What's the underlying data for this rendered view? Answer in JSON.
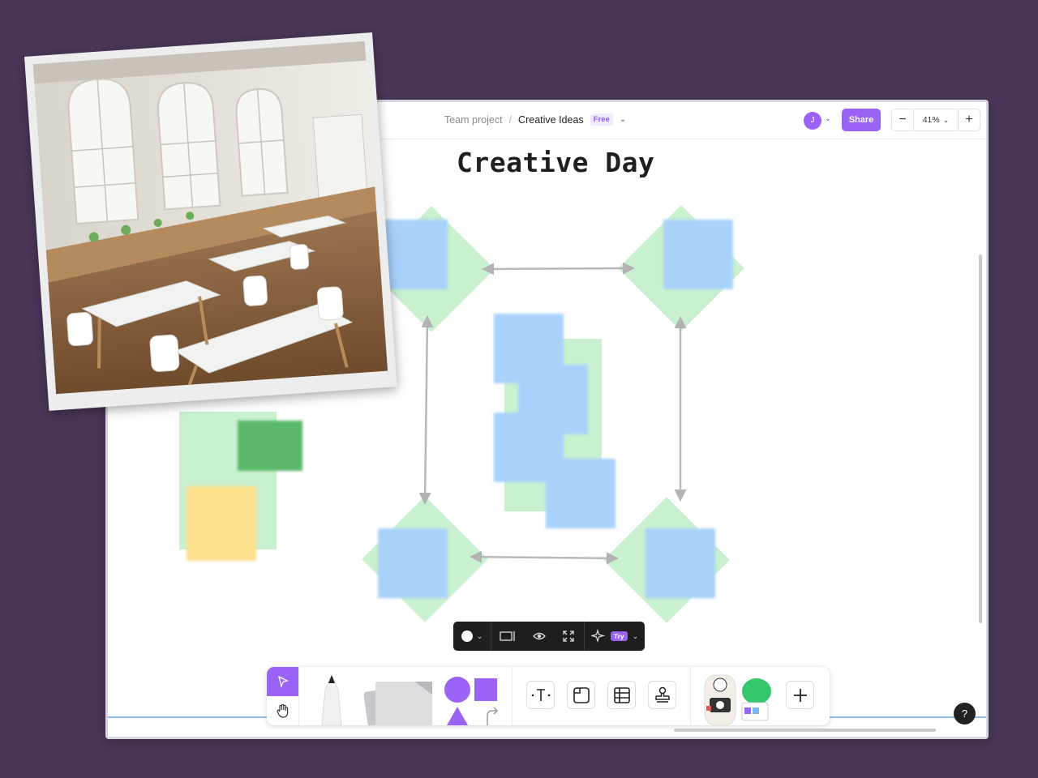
{
  "breadcrumb": {
    "parent": "Team project",
    "separator": "/",
    "title": "Creative Ideas",
    "plan_badge": "Free"
  },
  "header": {
    "user_initial": "J",
    "share_label": "Share",
    "zoom_level": "41%",
    "zoom_out": "−",
    "zoom_in": "+"
  },
  "board": {
    "title": "Creative Day"
  },
  "context_toolbar": {
    "ai_badge": "Try"
  },
  "help": {
    "label": "?"
  },
  "colors": {
    "accent": "#9b63f5",
    "background": "#4b3759",
    "sticky_blue": "#a9d2fb",
    "frame_green": "#c9f0cf"
  },
  "icons": {
    "zoom_chevron": "chevron-down-icon",
    "select_tool": "cursor-icon",
    "hand_tool": "hand-icon",
    "pen_tool": "pen-icon",
    "sticky_tool": "sticky-note-icon",
    "shapes_tool": "shapes-icon",
    "text_tool": "text-icon",
    "section_tool": "section-icon",
    "table_tool": "table-icon",
    "stamp_tool": "stamp-icon",
    "stickers": "sticker-icon",
    "add_more": "plus-icon"
  }
}
